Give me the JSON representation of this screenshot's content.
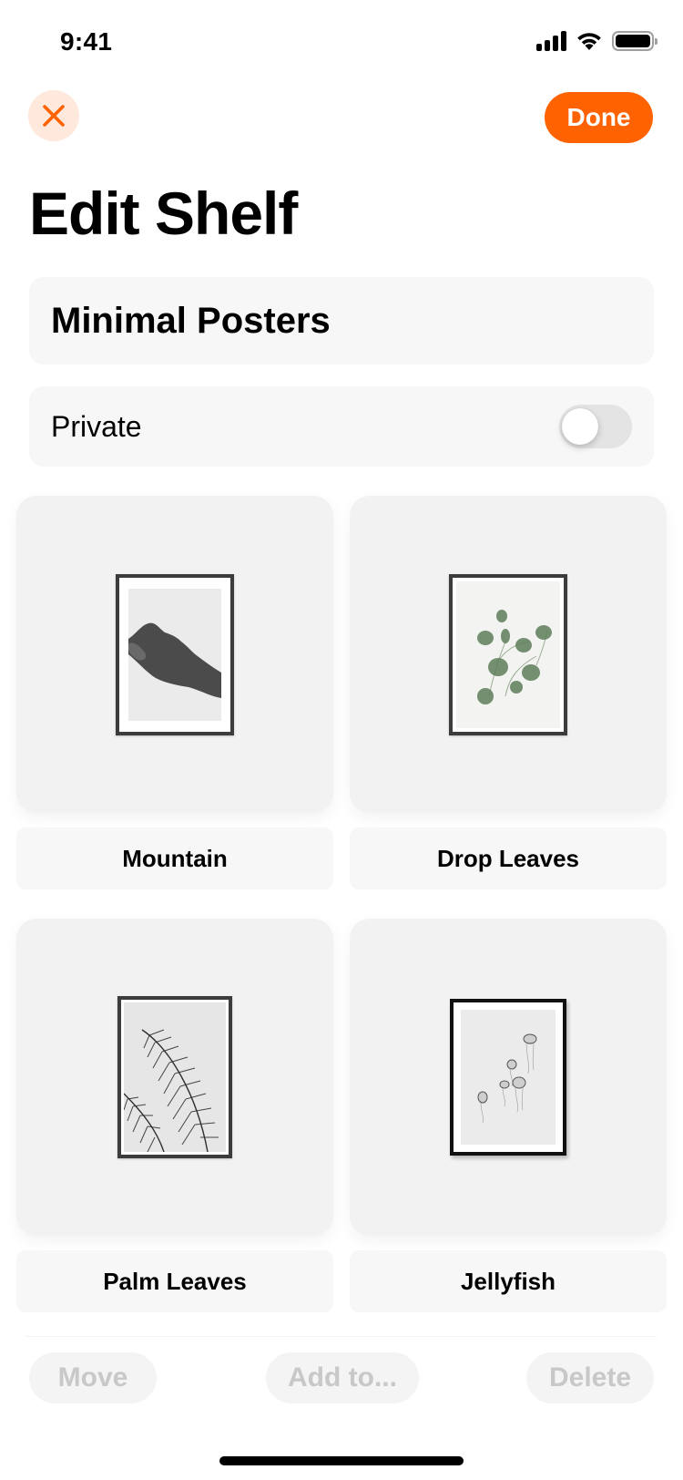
{
  "status_bar": {
    "time": "9:41",
    "icons": [
      "cellular-signal-icon",
      "wifi-icon",
      "battery-icon"
    ]
  },
  "nav": {
    "close_icon": "close-x-icon",
    "done_label": "Done"
  },
  "page": {
    "title": "Edit Shelf"
  },
  "shelf": {
    "name_value": "Minimal Posters",
    "private_label": "Private",
    "private_enabled": false
  },
  "items": [
    {
      "label": "Mountain",
      "image": "mountain-poster"
    },
    {
      "label": "Drop Leaves",
      "image": "drop-leaves-poster"
    },
    {
      "label": "Palm Leaves",
      "image": "palm-leaves-poster"
    },
    {
      "label": "Jellyfish",
      "image": "jellyfish-poster"
    }
  ],
  "actions": {
    "move_label": "Move",
    "add_to_label": "Add to...",
    "delete_label": "Delete",
    "enabled": false
  },
  "colors": {
    "accent": "#FF6200",
    "accent_soft": "#FFE8DC",
    "disabled_text": "#C8C8C8"
  }
}
